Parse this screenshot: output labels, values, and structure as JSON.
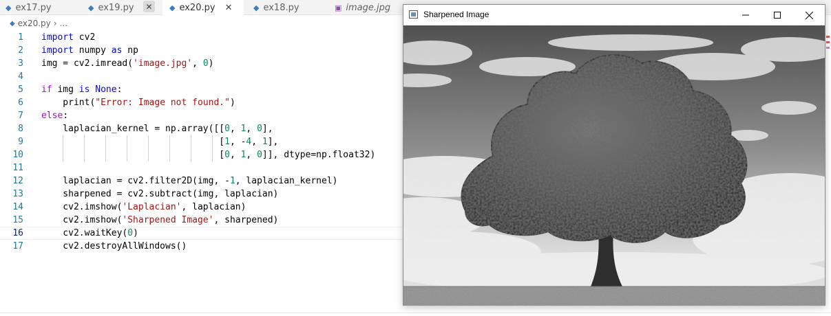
{
  "tabs": [
    {
      "label": "ex17.py"
    },
    {
      "label": "ex19.py",
      "close": "✕"
    },
    {
      "label": "ex20.py",
      "close": "✕"
    },
    {
      "label": "ex18.py"
    },
    {
      "label": "image.jpg"
    }
  ],
  "breadcrumb": {
    "file": "ex20.py",
    "separator": "›",
    "rest": "..."
  },
  "code": {
    "lines": [
      {
        "num": "1",
        "html": "<span class=\"kw\">import</span> cv2"
      },
      {
        "num": "2",
        "html": "<span class=\"kw\">import</span> numpy <span class=\"kw\">as</span> np"
      },
      {
        "num": "3",
        "html": "img = cv2.imread(<span class=\"str\">'image.jpg'</span>, <span class=\"num\">0</span>)"
      },
      {
        "num": "4",
        "html": ""
      },
      {
        "num": "5",
        "html": "<span class=\"ctl\">if</span> img <span class=\"kw\">is</span> <span class=\"kw\">None</span>:"
      },
      {
        "num": "6",
        "html": "    print(<span class=\"str\">\"Error: Image not found.\"</span>)"
      },
      {
        "num": "7",
        "html": "<span class=\"ctl\">else</span>:"
      },
      {
        "num": "8",
        "html": "    laplacian_kernel = np.array([[<span class=\"num\">0</span>, <span class=\"num\">1</span>, <span class=\"num\">0</span>],"
      },
      {
        "num": "9",
        "html": "                                 [<span class=\"num\">1</span>, -<span class=\"num\">4</span>, <span class=\"num\">1</span>],"
      },
      {
        "num": "10",
        "html": "                                 [<span class=\"num\">0</span>, <span class=\"num\">1</span>, <span class=\"num\">0</span>]], dtype=np.float32)"
      },
      {
        "num": "11",
        "html": ""
      },
      {
        "num": "12",
        "html": "    laplacian = cv2.filter2D(img, -<span class=\"num\">1</span>, laplacian_kernel)"
      },
      {
        "num": "13",
        "html": "    sharpened = cv2.subtract(img, laplacian)"
      },
      {
        "num": "14",
        "html": "    cv2.imshow(<span class=\"str\">'Laplacian'</span>, laplacian)"
      },
      {
        "num": "15",
        "html": "    cv2.imshow(<span class=\"str\">'Sharpened Image'</span>, sharpened)"
      },
      {
        "num": "16",
        "html": "    cv2.waitKey(<span class=\"num\">0</span>)"
      },
      {
        "num": "17",
        "html": "    cv2.destroyAllWindows()"
      }
    ]
  },
  "window": {
    "title": "Sharpened Image"
  },
  "colors": {
    "python_icon": "#3b7bbf",
    "line_number": "#237893",
    "keyword": "#0000ff",
    "string": "#a31515",
    "number": "#098658"
  }
}
